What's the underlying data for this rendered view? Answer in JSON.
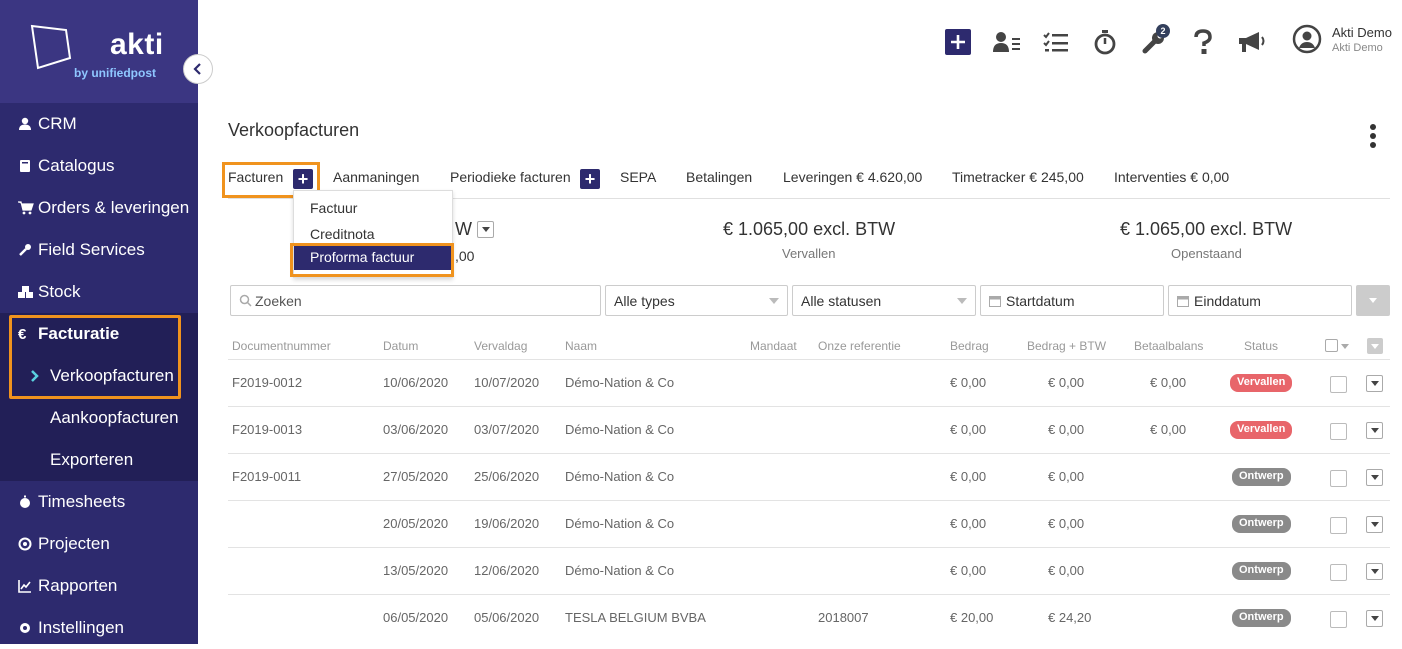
{
  "brand": {
    "name": "akti",
    "tagline": "by unifiedpost"
  },
  "sidebar": {
    "items": [
      {
        "label": "CRM",
        "icon": "user-icon"
      },
      {
        "label": "Catalogus",
        "icon": "book-icon"
      },
      {
        "label": "Orders & leveringen",
        "icon": "cart-icon"
      },
      {
        "label": "Field Services",
        "icon": "wrench-icon"
      },
      {
        "label": "Stock",
        "icon": "cubes-icon"
      },
      {
        "label": "Facturatie",
        "icon": "euro-icon"
      },
      {
        "label": "Verkoopfacturen",
        "icon": "chevron-right-icon"
      },
      {
        "label": "Aankoopfacturen"
      },
      {
        "label": "Exporteren"
      },
      {
        "label": "Timesheets",
        "icon": "stopwatch-icon"
      },
      {
        "label": "Projecten",
        "icon": "target-icon"
      },
      {
        "label": "Rapporten",
        "icon": "chart-icon"
      },
      {
        "label": "Instellingen",
        "icon": "gear-icon"
      }
    ]
  },
  "header": {
    "notifications_badge": "2",
    "user_name": "Akti Demo",
    "user_company": "Akti Demo"
  },
  "page": {
    "title": "Verkoopfacturen"
  },
  "tabs": {
    "facturen": "Facturen",
    "aanmaningen": "Aanmaningen",
    "periodieke": "Periodieke facturen",
    "sepa": "SEPA",
    "betalingen": "Betalingen",
    "leveringen": "Leveringen € 4.620,00",
    "timetracker": "Timetracker € 245,00",
    "interventies": "Interventies € 0,00"
  },
  "dropdown": {
    "items": [
      "Factuur",
      "Creditnota",
      "Proforma factuur"
    ]
  },
  "stats": {
    "first_value_visible": "W",
    "first_label_visible": ",00",
    "second_value": "€ 1.065,00 excl. BTW",
    "second_label": "Vervallen",
    "third_value": "€ 1.065,00 excl. BTW",
    "third_label": "Openstaand"
  },
  "filters": {
    "search_placeholder": "Zoeken",
    "types": "Alle types",
    "statuses": "Alle statusen",
    "start": "Startdatum",
    "end": "Einddatum"
  },
  "table": {
    "columns": [
      "Documentnummer",
      "Datum",
      "Vervaldag",
      "Naam",
      "Mandaat",
      "Onze referentie",
      "Bedrag",
      "Bedrag + BTW",
      "Betaalbalans",
      "Status"
    ],
    "rows": [
      {
        "doc": "F2019-0012",
        "date": "10/06/2020",
        "due": "10/07/2020",
        "name": "Démo-Nation & Co",
        "ref": "",
        "amount": "€ 0,00",
        "amount_vat": "€ 0,00",
        "balance": "€ 0,00",
        "status": "Vervallen",
        "status_color": "#e8656a"
      },
      {
        "doc": "F2019-0013",
        "date": "03/06/2020",
        "due": "03/07/2020",
        "name": "Démo-Nation & Co",
        "ref": "",
        "amount": "€ 0,00",
        "amount_vat": "€ 0,00",
        "balance": "€ 0,00",
        "status": "Vervallen",
        "status_color": "#e8656a"
      },
      {
        "doc": "F2019-0011",
        "date": "27/05/2020",
        "due": "25/06/2020",
        "name": "Démo-Nation & Co",
        "ref": "",
        "amount": "€ 0,00",
        "amount_vat": "€ 0,00",
        "balance": "",
        "status": "Ontwerp",
        "status_color": "#8a8a8a"
      },
      {
        "doc": "",
        "date": "20/05/2020",
        "due": "19/06/2020",
        "name": "Démo-Nation & Co",
        "ref": "",
        "amount": "€ 0,00",
        "amount_vat": "€ 0,00",
        "balance": "",
        "status": "Ontwerp",
        "status_color": "#8a8a8a"
      },
      {
        "doc": "",
        "date": "13/05/2020",
        "due": "12/06/2020",
        "name": "Démo-Nation & Co",
        "ref": "",
        "amount": "€ 0,00",
        "amount_vat": "€ 0,00",
        "balance": "",
        "status": "Ontwerp",
        "status_color": "#8a8a8a"
      },
      {
        "doc": "",
        "date": "06/05/2020",
        "due": "05/06/2020",
        "name": "TESLA BELGIUM BVBA",
        "ref": "2018007",
        "amount": "€ 20,00",
        "amount_vat": "€ 24,20",
        "balance": "",
        "status": "Ontwerp",
        "status_color": "#8a8a8a"
      }
    ]
  },
  "colors": {
    "sidebar": "#2d2a6e",
    "accent_highlight": "#f0931e",
    "overdue": "#e8656a",
    "draft": "#8a8a8a"
  }
}
